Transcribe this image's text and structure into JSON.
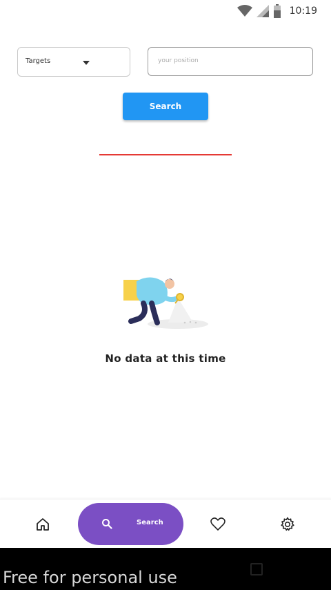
{
  "status_bar": {
    "time": "10:19"
  },
  "filters": {
    "targets_label": "Targets",
    "position_placeholder": "your position"
  },
  "search_button_label": "Search",
  "empty_state": {
    "message": "No data at this time"
  },
  "bottom_nav": {
    "items": [
      {
        "icon": "home-icon"
      },
      {
        "icon": "search-icon",
        "label": "Search",
        "active": true
      },
      {
        "icon": "heart-icon"
      },
      {
        "icon": "gear-icon"
      }
    ],
    "active_color": "#7b4fc4"
  },
  "accent_colors": {
    "primary": "#2196f3",
    "divider": "#e53935"
  },
  "watermark": "Free for personal use"
}
